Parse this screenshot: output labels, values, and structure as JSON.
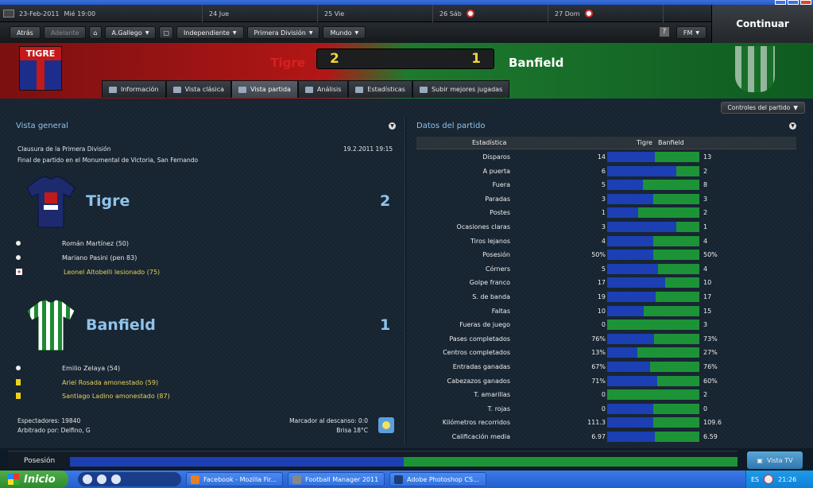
{
  "window": {
    "title": "Football Manager 2011"
  },
  "calendar": [
    {
      "date": "23-Feb-2011",
      "time": "Mié 19:00"
    },
    {
      "label": "24 Jue"
    },
    {
      "label": "25 Vie"
    },
    {
      "label": "26 Sáb"
    },
    {
      "label": "27 Dom"
    }
  ],
  "nav": {
    "back": "Atrás",
    "forward": "Adelante",
    "manager": "A.Gallego",
    "club": "Independiente",
    "competition": "Primera División",
    "world": "Mundo",
    "fm": "FM",
    "help": "?",
    "continue": "Continuar"
  },
  "match": {
    "home": "Tigre",
    "away": "Banfield",
    "home_score": "2",
    "away_score": "1",
    "home_crest": "TIGRE"
  },
  "tabs": [
    "Información",
    "Vista clásica",
    "Vista partida",
    "Análisis",
    "Estadísticas",
    "Subir mejores jugadas"
  ],
  "controls": "Controles del partido",
  "overview": {
    "title": "Vista general",
    "competition": "Clausura de la Primera División",
    "datetime": "19.2.2011 19:15",
    "venue": "Final de partido en el Monumental de Victoria, San Fernando",
    "home_events": [
      {
        "text": "Román Martínez (50)",
        "type": "goal"
      },
      {
        "text": "Mariano Pasini (pen 83)",
        "type": "goal"
      },
      {
        "text": "Leonel Altobelli lesionado (75)",
        "type": "injury"
      }
    ],
    "away_events": [
      {
        "text": "Emilio Zelaya (54)",
        "type": "goal"
      },
      {
        "text": "Ariel Rosada amonestado (59)",
        "type": "yellow"
      },
      {
        "text": "Santiago Ladino amonestado (87)",
        "type": "yellow"
      }
    ],
    "attendance": "Espectadores: 19840",
    "referee": "Arbitrado por: Delfino, G",
    "halftime": "Marcador al descanso: 0:0",
    "weather": "Brisa 18°C"
  },
  "stats": {
    "title": "Datos del partido",
    "col_header": "Estadística",
    "home": "Tigre",
    "away": "Banfield",
    "rows": [
      {
        "label": "Disparos",
        "home": "14",
        "away": "13",
        "h": 14,
        "a": 13
      },
      {
        "label": "A puerta",
        "home": "6",
        "away": "2",
        "h": 6,
        "a": 2
      },
      {
        "label": "Fuera",
        "home": "5",
        "away": "8",
        "h": 5,
        "a": 8
      },
      {
        "label": "Paradas",
        "home": "3",
        "away": "3",
        "h": 3,
        "a": 3
      },
      {
        "label": "Postes",
        "home": "1",
        "away": "2",
        "h": 1,
        "a": 2
      },
      {
        "label": "Ocasiones claras",
        "home": "3",
        "away": "1",
        "h": 3,
        "a": 1
      },
      {
        "label": "Tiros lejanos",
        "home": "4",
        "away": "4",
        "h": 4,
        "a": 4
      },
      {
        "label": "Posesión",
        "home": "50%",
        "away": "50%",
        "h": 50,
        "a": 50
      },
      {
        "label": "Córners",
        "home": "5",
        "away": "4",
        "h": 5,
        "a": 4
      },
      {
        "label": "Golpe franco",
        "home": "17",
        "away": "10",
        "h": 17,
        "a": 10
      },
      {
        "label": "S. de banda",
        "home": "19",
        "away": "17",
        "h": 19,
        "a": 17
      },
      {
        "label": "Faltas",
        "home": "10",
        "away": "15",
        "h": 10,
        "a": 15
      },
      {
        "label": "Fueras de juego",
        "home": "0",
        "away": "3",
        "h": 0,
        "a": 3
      },
      {
        "label": "Pases completados",
        "home": "76%",
        "away": "73%",
        "h": 76,
        "a": 73
      },
      {
        "label": "Centros completados",
        "home": "13%",
        "away": "27%",
        "h": 13,
        "a": 27
      },
      {
        "label": "Entradas ganadas",
        "home": "67%",
        "away": "76%",
        "h": 67,
        "a": 76
      },
      {
        "label": "Cabezazos ganados",
        "home": "71%",
        "away": "60%",
        "h": 71,
        "a": 60
      },
      {
        "label": "T. amarillas",
        "home": "0",
        "away": "2",
        "h": 0,
        "a": 2
      },
      {
        "label": "T. rojas",
        "home": "0",
        "away": "0",
        "h": 0,
        "a": 0
      },
      {
        "label": "Kilómetros recorridos",
        "home": "111.3",
        "away": "109.6",
        "h": 111.3,
        "a": 109.6
      },
      {
        "label": "Calificación media",
        "home": "6.97",
        "away": "6.59",
        "h": 6.97,
        "a": 6.59
      }
    ]
  },
  "possession": {
    "label": "Posesión",
    "home": 50,
    "away": 50
  },
  "tv": "Vista TV",
  "taskbar": {
    "start": "Inicio",
    "tasks": [
      "Facebook - Mozilla Fir...",
      "Football Manager 2011",
      "Adobe Photoshop CS..."
    ],
    "lang": "ES",
    "clock": "21:26"
  },
  "colors": {
    "home": "#1c3fb4",
    "away": "#1d9338",
    "accent": "#8fc3ea"
  }
}
